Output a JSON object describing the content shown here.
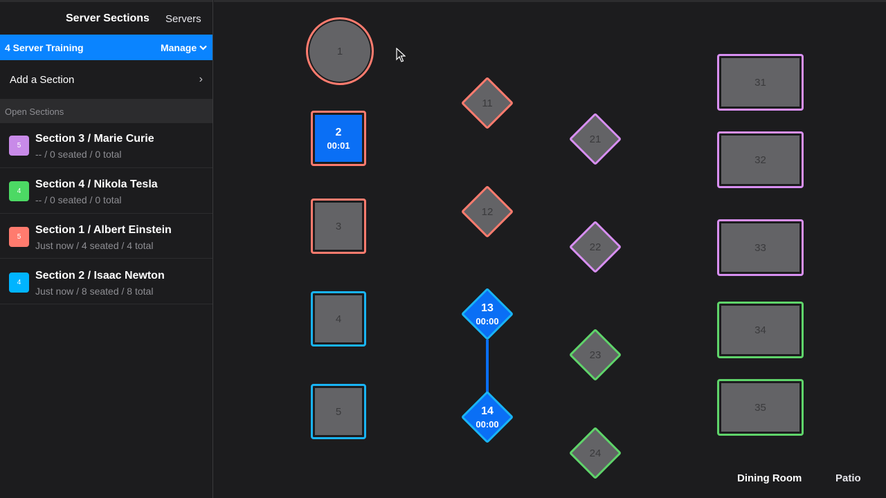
{
  "sidebar": {
    "title": "Server Sections",
    "servers_label": "Servers",
    "selected": {
      "label": "4 Server Training",
      "manage_label": "Manage"
    },
    "add_section_label": "Add a Section",
    "group_label": "Open Sections",
    "sections": [
      {
        "badge": "5",
        "badge_color": "#c88ae8",
        "name": "Section 3 / Marie Curie",
        "sub": "-- / 0 seated / 0 total"
      },
      {
        "badge": "4",
        "badge_color": "#4cd964",
        "name": "Section 4 / Nikola Tesla",
        "sub": "-- / 0 seated / 0 total"
      },
      {
        "badge": "5",
        "badge_color": "#ff7b6e",
        "name": "Section 1 / Albert Einstein",
        "sub": "Just now / 4 seated / 4 total"
      },
      {
        "badge": "4",
        "badge_color": "#00b4ff",
        "name": "Section 2 / Isaac Newton",
        "sub": "Just now / 8 seated / 8 total"
      }
    ]
  },
  "tables": {
    "t1": "1",
    "t2": "2",
    "t2_time": "00:01",
    "t3": "3",
    "t4": "4",
    "t5": "5",
    "t11": "11",
    "t12": "12",
    "t13": "13",
    "t13_time": "00:00",
    "t14": "14",
    "t14_time": "00:00",
    "t21": "21",
    "t22": "22",
    "t23": "23",
    "t24": "24",
    "t31": "31",
    "t32": "32",
    "t33": "33",
    "t34": "34",
    "t35": "35"
  },
  "rooms": {
    "dining": "Dining Room",
    "patio": "Patio"
  },
  "colors": {
    "accent": "#0a84ff",
    "section1": "#ff7b6e",
    "section2": "#19b4f5",
    "section3": "#d88ff2",
    "section4": "#5fd46a"
  }
}
